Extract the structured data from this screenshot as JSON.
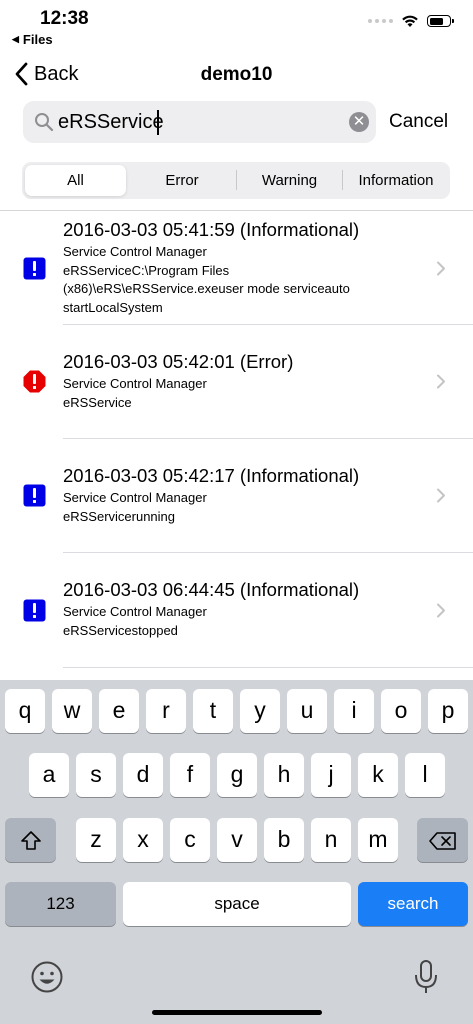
{
  "status_bar": {
    "time": "12:38",
    "back_app": "Files"
  },
  "nav": {
    "back_label": "Back",
    "title": "demo10"
  },
  "search": {
    "value": "eRSService",
    "cancel_label": "Cancel"
  },
  "segments": [
    "All",
    "Error",
    "Warning",
    "Information"
  ],
  "selected_segment": "All",
  "events": [
    {
      "title": "2016-03-03 05:41:59 (Informational)",
      "source": "Service Control Manager",
      "detail_lines": [
        "eRSServiceC:\\Program Files",
        "(x86)\\eRS\\eRSService.exeuser mode serviceauto",
        "startLocalSystem"
      ],
      "level": "info",
      "icon_color": "#0000e6"
    },
    {
      "title": "2016-03-03 05:42:01 (Error)",
      "source": "Service Control Manager",
      "detail_lines": [
        "eRSService"
      ],
      "level": "error",
      "icon_color": "#e60000"
    },
    {
      "title": "2016-03-03 05:42:17 (Informational)",
      "source": "Service Control Manager",
      "detail_lines": [
        "eRSServicerunning"
      ],
      "level": "info",
      "icon_color": "#0000e6"
    },
    {
      "title": "2016-03-03 06:44:45 (Informational)",
      "source": "Service Control Manager",
      "detail_lines": [
        "eRSServicestopped"
      ],
      "level": "info",
      "icon_color": "#0000e6"
    }
  ],
  "keyboard": {
    "row1": [
      "q",
      "w",
      "e",
      "r",
      "t",
      "y",
      "u",
      "i",
      "o",
      "p"
    ],
    "row2": [
      "a",
      "s",
      "d",
      "f",
      "g",
      "h",
      "j",
      "k",
      "l"
    ],
    "row3": [
      "z",
      "x",
      "c",
      "v",
      "b",
      "n",
      "m"
    ],
    "numbers_label": "123",
    "space_label": "space",
    "search_label": "search"
  },
  "colors": {
    "accent": "#1a7ef6",
    "info": "#0000e6",
    "error": "#e60000"
  }
}
